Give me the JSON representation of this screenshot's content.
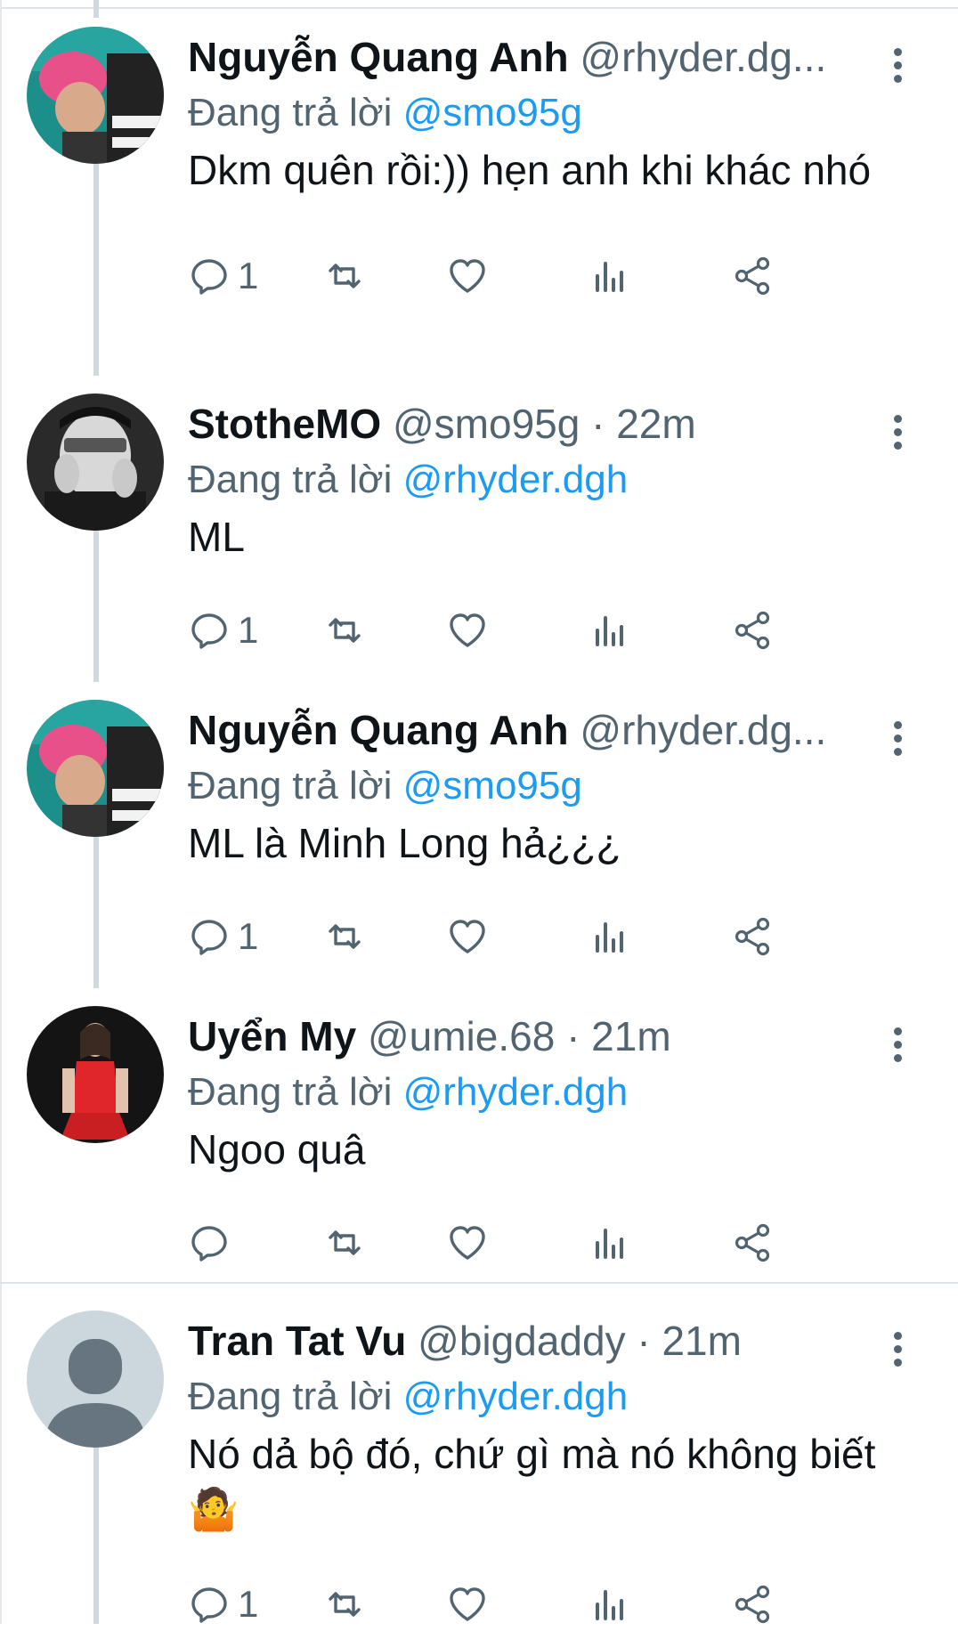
{
  "reply_prefix": "Đang trả lời",
  "tweets": [
    {
      "name": "Nguyễn Quang Anh",
      "handle": "@rhyder.dg...",
      "reply_to": "@smo95g",
      "text": "Dkm quên rồi:)) hẹn anh khi khác nhó",
      "reply_count": "1",
      "avatar": "pink-hair-avatar"
    },
    {
      "name": "StotheMO",
      "handle": "@smo95g · 22m",
      "reply_to": "@rhyder.dgh",
      "text": "ML",
      "reply_count": "1",
      "avatar": "bw-glasses-avatar"
    },
    {
      "name": "Nguyễn Quang Anh",
      "handle": "@rhyder.dg...",
      "reply_to": "@smo95g",
      "text": "ML là Minh Long hả¿¿¿",
      "reply_count": "1",
      "avatar": "pink-hair-avatar"
    },
    {
      "name": "Uyển My",
      "handle": "@umie.68 · 21m",
      "reply_to": "@rhyder.dgh",
      "text": "Ngoo quâ",
      "reply_count": "",
      "avatar": "red-dress-avatar"
    },
    {
      "name": "Tran Tat Vu",
      "handle": "@bigdaddy · 21m",
      "reply_to": "@rhyder.dgh",
      "text": "Nó dả bộ đó, chứ gì mà nó không biết 🤷",
      "reply_count": "1",
      "avatar": "default-user-avatar"
    }
  ],
  "colors": {
    "mention": "#1d9bf0",
    "muted": "#536471",
    "thread_line": "#cfd9de"
  }
}
